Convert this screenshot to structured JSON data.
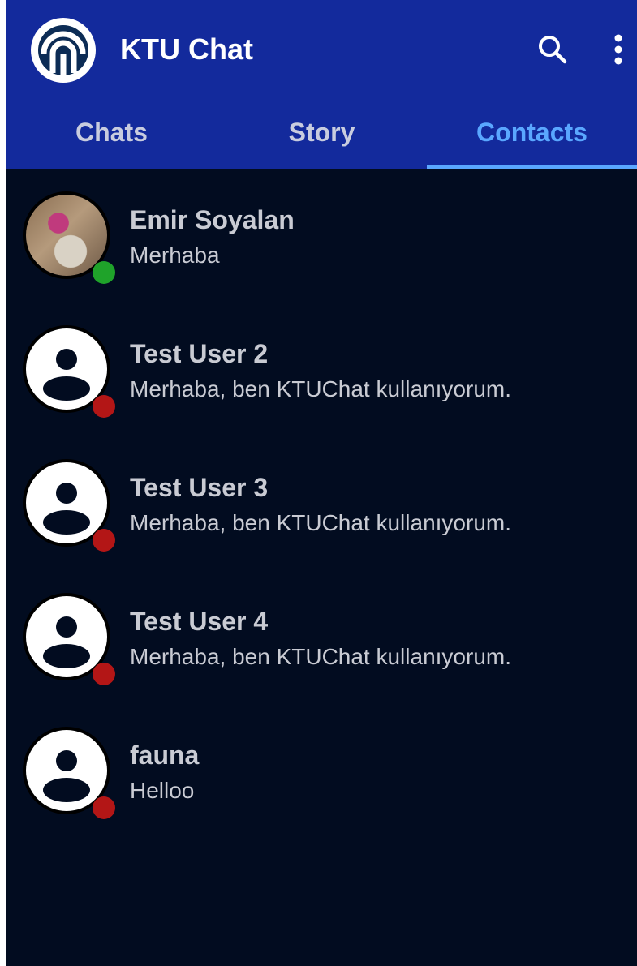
{
  "app": {
    "title": "KTU Chat",
    "logo_icon": "ktu-logo-icon",
    "actions": [
      {
        "name": "search-icon"
      },
      {
        "name": "more-vertical-icon"
      }
    ]
  },
  "tabs": [
    {
      "label": "Chats",
      "active": false
    },
    {
      "label": "Story",
      "active": false
    },
    {
      "label": "Contacts",
      "active": true
    }
  ],
  "contacts": [
    {
      "name": "Emir Soyalan",
      "message": "Merhaba",
      "online": true,
      "avatar": "photo"
    },
    {
      "name": "Test User 2",
      "message": "Merhaba, ben KTUChat kullanıyorum.",
      "online": false,
      "avatar": "default"
    },
    {
      "name": "Test User 3",
      "message": "Merhaba, ben KTUChat kullanıyorum.",
      "online": false,
      "avatar": "default"
    },
    {
      "name": "Test User 4",
      "message": "Merhaba, ben KTUChat kullanıyorum.",
      "online": false,
      "avatar": "default"
    },
    {
      "name": "fauna",
      "message": "Helloo",
      "online": false,
      "avatar": "default"
    }
  ],
  "colors": {
    "appbar": "#132a9c",
    "background": "#020c20",
    "accent": "#5aa7ff",
    "online": "#1fa32a",
    "offline": "#b31616"
  }
}
